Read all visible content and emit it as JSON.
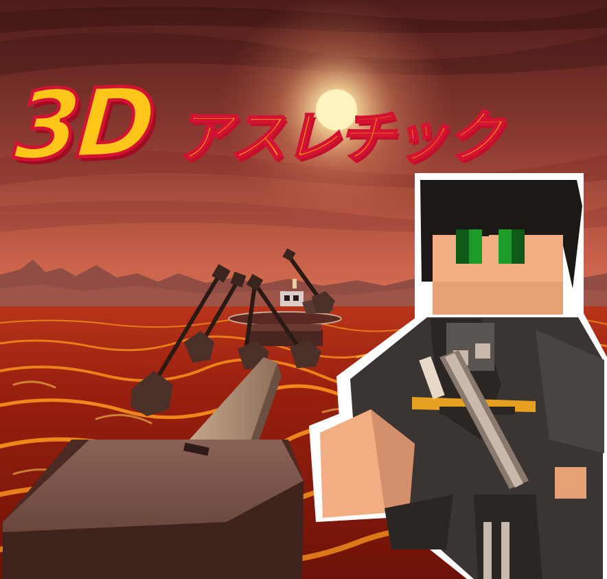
{
  "title": {
    "number_part": "3D",
    "katakana_part": "アスレチック"
  },
  "colors": {
    "sky_top": "#5e2320",
    "sky_horizon": "#c25a42",
    "sun": "#fff3c0",
    "lava_dark": "#8a1a0c",
    "lava_bright": "#ff9a1e",
    "title_yellow": "#ffc61a",
    "title_orange": "#ff9a12",
    "title_outline": "#d41332",
    "platform_stone": "#6e4a40",
    "plank": "#a88a72",
    "character_hair": "#1c1816",
    "character_skin": "#f2ae82",
    "character_eyes": "#1c9a2a",
    "character_coat": "#3a3532",
    "character_accent": "#e8a020"
  },
  "scene": {
    "environment": "lava-sea-sunset",
    "course_elements": [
      "starting-platform",
      "balance-plank",
      "swinging-hammer-obstacles",
      "far-platform"
    ],
    "character": "blocky-avatar-black-coat"
  }
}
